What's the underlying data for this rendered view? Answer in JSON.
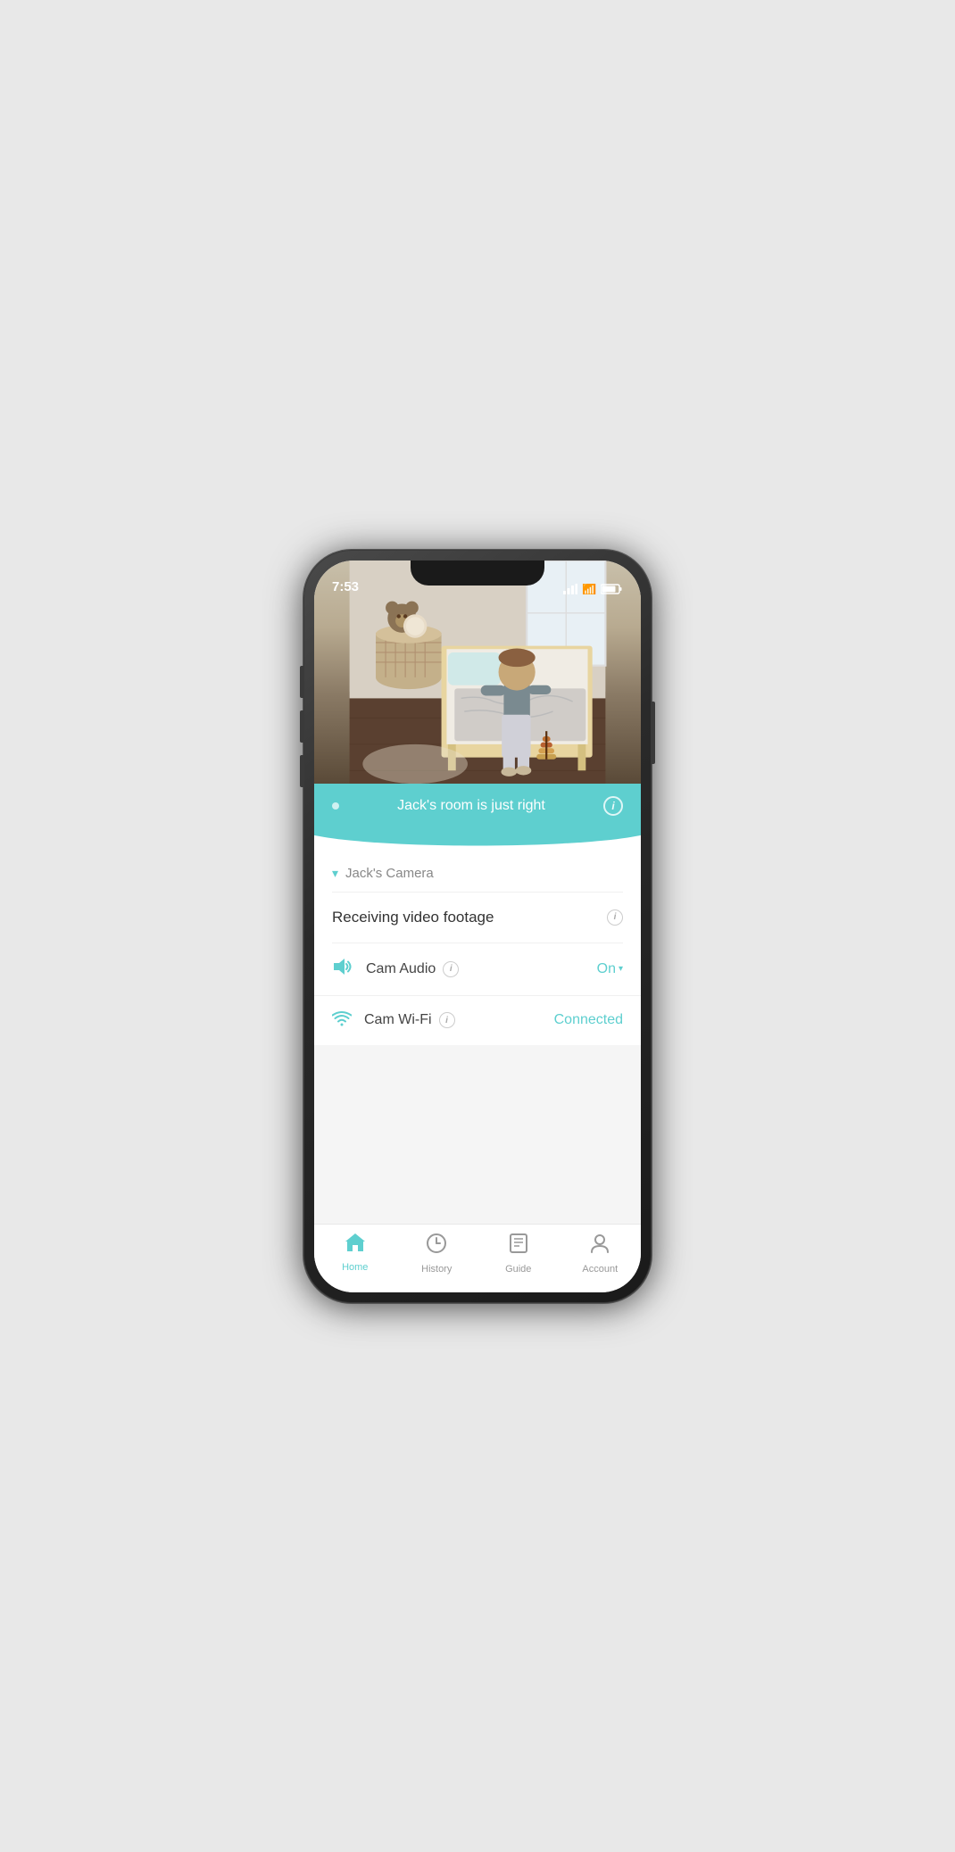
{
  "phone": {
    "status_time": "7:53"
  },
  "status_banner": {
    "text": "Jack's room is just right",
    "info_label": "i"
  },
  "camera": {
    "name": "Jack's Camera",
    "status": "Receiving video footage",
    "audio_label": "Cam Audio",
    "audio_value": "On",
    "wifi_label": "Cam Wi-Fi",
    "wifi_value": "Connected",
    "info_label": "i"
  },
  "tabs": {
    "home": {
      "label": "Home",
      "active": true
    },
    "history": {
      "label": "History",
      "active": false
    },
    "guide": {
      "label": "Guide",
      "active": false
    },
    "account": {
      "label": "Account",
      "active": false
    }
  }
}
